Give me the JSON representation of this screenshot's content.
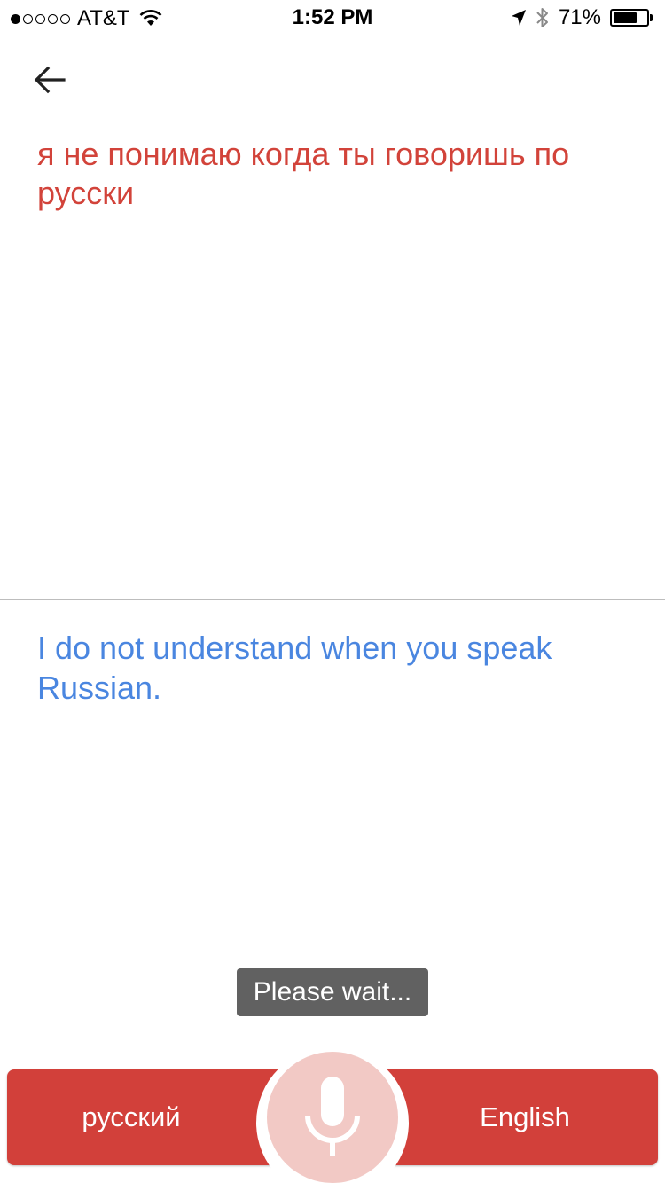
{
  "status_bar": {
    "carrier": "AT&T",
    "time": "1:52 PM",
    "battery_percent": "71%",
    "battery_level": 0.71,
    "signal_strength_dots": 1,
    "icons": [
      "wifi-icon",
      "location-arrow-icon",
      "bluetooth-icon",
      "battery-icon"
    ]
  },
  "header": {
    "back_icon": "arrow-left-icon"
  },
  "source": {
    "text": "я не понимаю когда ты говоришь по русски",
    "color": "#d2433a"
  },
  "translation": {
    "text": "I do not understand when you speak Russian.",
    "color": "#4a86e0"
  },
  "toast": {
    "text": "Please wait..."
  },
  "bottom_bar": {
    "source_language": "русский",
    "target_language": "English",
    "mic_icon": "microphone-icon",
    "bar_color": "#d2403a",
    "mic_color": "#f2c9c5"
  }
}
